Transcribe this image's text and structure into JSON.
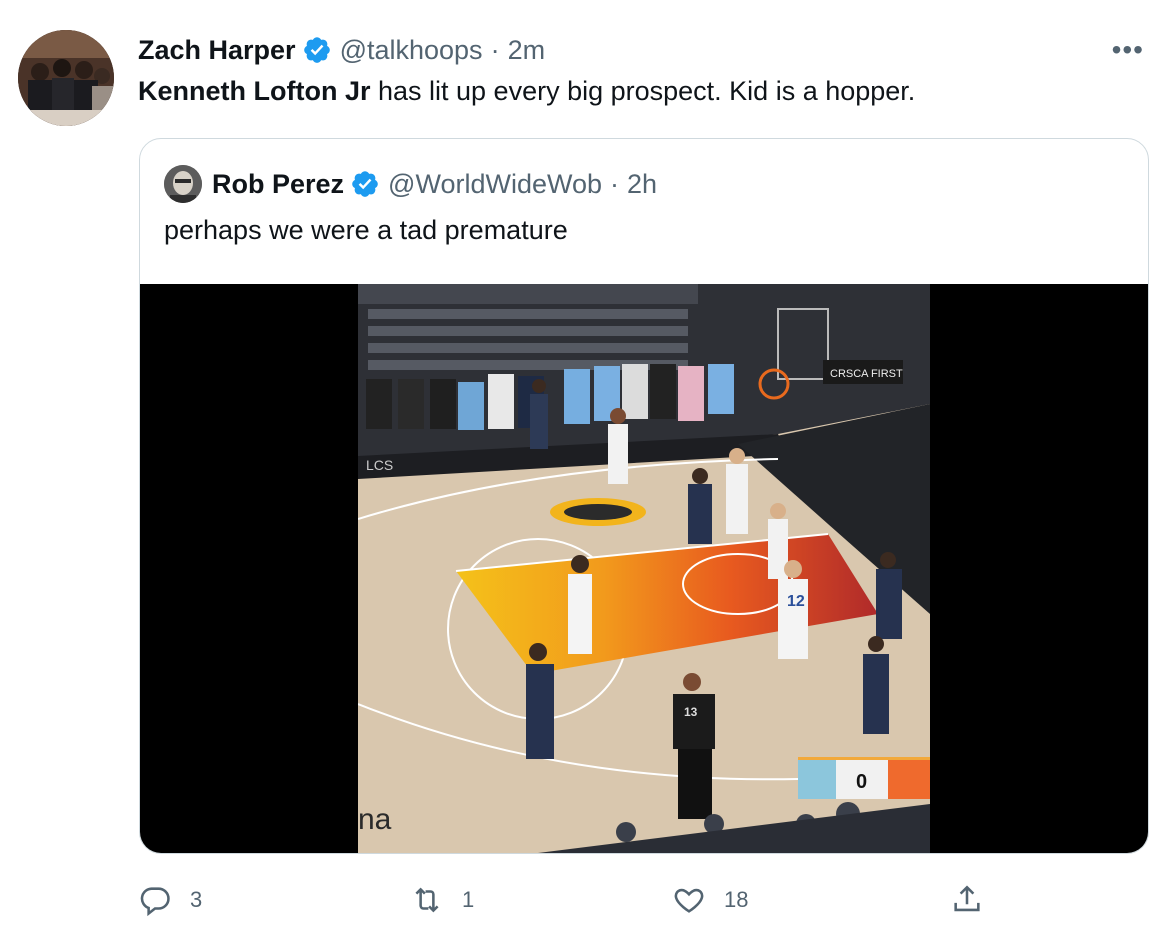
{
  "tweet": {
    "author_name": "Zach Harper",
    "handle": "@talkhoops",
    "separator": "·",
    "time": "2m",
    "more_label": "•••",
    "text_bold": "Kenneth Lofton Jr",
    "text_rest": " has lit up every big prospect. Kid is a hopper."
  },
  "quote": {
    "author_name": "Rob Perez",
    "handle": "@WorldWideWob",
    "separator": "·",
    "time": "2h",
    "text": "perhaps we were a tad premature",
    "video": {
      "score": "0",
      "court_text": "na",
      "referee_number": "13",
      "player_number": "12",
      "sponsor_text": "CRSCA FIRST"
    }
  },
  "actions": {
    "reply_count": "3",
    "retweet_count": "1",
    "like_count": "18"
  },
  "colors": {
    "verified": "#1d9bf0",
    "secondary_text": "#536471",
    "border": "#cfd9de"
  },
  "icons": [
    "verified-badge-icon",
    "more-icon",
    "reply-icon",
    "retweet-icon",
    "like-icon",
    "share-icon"
  ]
}
